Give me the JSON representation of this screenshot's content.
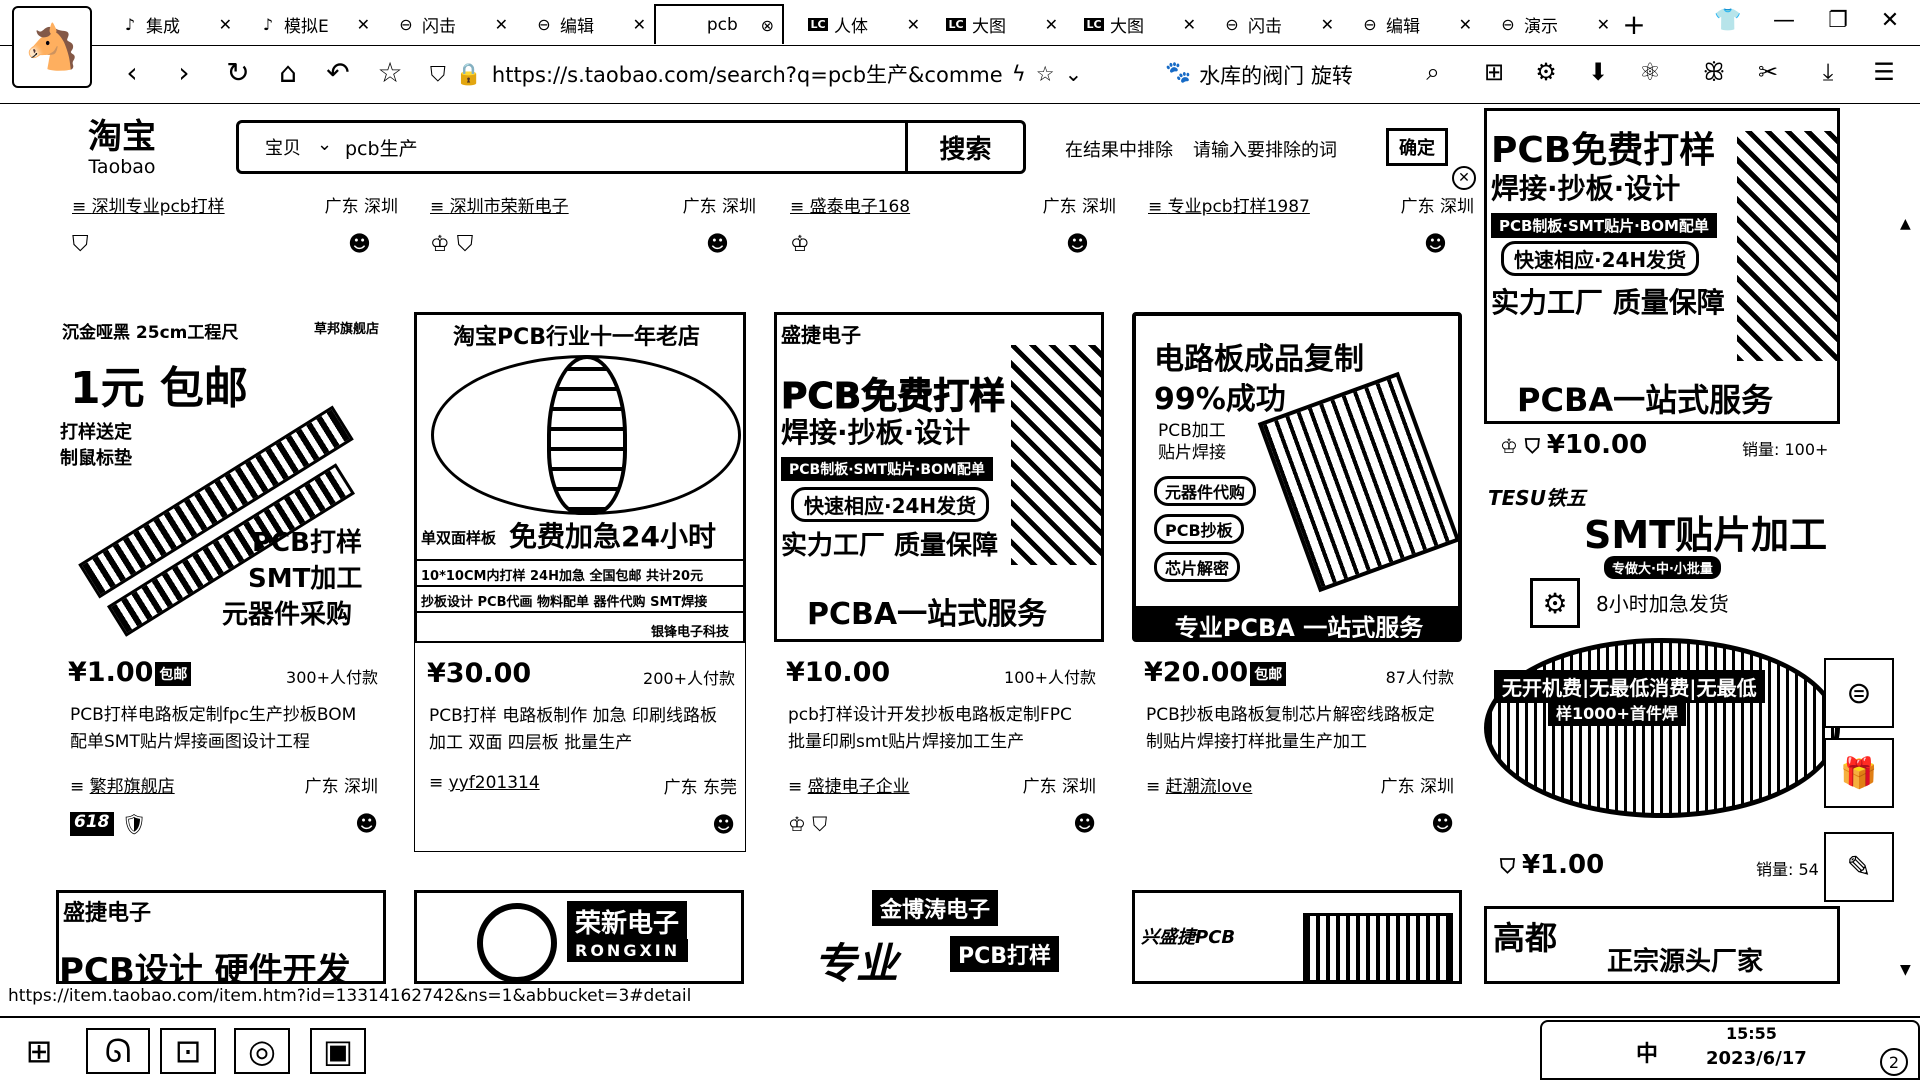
{
  "browser": {
    "tabs": [
      {
        "icon": "♪",
        "title": "集成",
        "active": false
      },
      {
        "icon": "♪",
        "title": "模拟E",
        "active": false
      },
      {
        "icon": "⊖",
        "title": "闪击",
        "active": false
      },
      {
        "icon": "⊖",
        "title": "编辑",
        "active": false
      },
      {
        "icon": "",
        "title": "pcb",
        "active": true
      },
      {
        "icon": "LC",
        "title": "人体",
        "active": false
      },
      {
        "icon": "LC",
        "title": "大图",
        "active": false
      },
      {
        "icon": "LC",
        "title": "大图",
        "active": false
      },
      {
        "icon": "⊖",
        "title": "闪击",
        "active": false
      },
      {
        "icon": "⊖",
        "title": "编辑",
        "active": false
      },
      {
        "icon": "⊖",
        "title": "演示",
        "active": false
      }
    ],
    "new_tab": "+",
    "url": "https://s.taobao.com/search?q=pcb生产&commer",
    "hot_search": "水库的阀门 旋转",
    "status_url": "https://item.taobao.com/item.htm?id=13314162742&ns=1&abbucket=3#detail"
  },
  "taobao": {
    "logo_cn": "淘宝",
    "logo_en": "Taobao",
    "search_category": "宝贝",
    "search_query": "pcb生产",
    "search_button": "搜索",
    "exclude_label": "在结果中排除",
    "exclude_placeholder": "请输入要排除的词",
    "confirm_button": "确定"
  },
  "top_shops": [
    {
      "shop": "深圳专业pcb打样",
      "location": "广东 深圳"
    },
    {
      "shop": "深圳市荣新电子",
      "location": "广东 深圳"
    },
    {
      "shop": "盛泰电子168",
      "location": "广东 深圳"
    },
    {
      "shop": "专业pcb打样1987",
      "location": "广东 深圳"
    }
  ],
  "products": [
    {
      "price": "¥1.00",
      "tag": "包邮",
      "sold": "300+人付款",
      "title": "PCB打样电路板定制fpc生产抄板BOM配单SMT贴片焊接画图设计工程",
      "shop": "繁邦旗舰店",
      "location": "广东 深圳",
      "badge": "618",
      "img": {
        "l1": "沉金哑黑 25cm工程尺",
        "l2": "草邦旗舰店",
        "l3": "1元 包邮",
        "l4": "打样送定制鼠标垫",
        "l5": "PCB打样",
        "l6": "SMT加工",
        "l7": "元器件采购"
      }
    },
    {
      "price": "¥30.00",
      "tag": "",
      "sold": "200+人付款",
      "title": "PCB打样 电路板制作 加急 印刷线路板加工 双面 四层板 批量生产",
      "shop": "yyf201314",
      "location": "广东 东莞",
      "badge": "",
      "img": {
        "l1": "淘宝PCB行业十一年老店",
        "l2": "单双面样板",
        "l3": "免费加急24小时",
        "l4": "10*10CM内打样 24H加急 全国包邮 共计20元",
        "l5": "抄板设计 PCB代画 物料配单 器件代购 SMT焊接",
        "l6": "银锋电子科技"
      }
    },
    {
      "price": "¥10.00",
      "tag": "",
      "sold": "100+人付款",
      "title": "pcb打样设计开发抄板电路板定制FPC批量印刷smt贴片焊接加工生产",
      "shop": "盛捷电子企业",
      "location": "广东 深圳",
      "badge": "",
      "img": {
        "l1": "盛捷电子",
        "l2": "PCB免费打样",
        "l3": "焊接·抄板·设计",
        "l4": "PCB制板·SMT贴片·BOM配单",
        "l5": "快速相应·24H发货",
        "l6": "实力工厂 质量保障",
        "l7": "PCBA一站式服务"
      }
    },
    {
      "price": "¥20.00",
      "tag": "包邮",
      "sold": "87人付款",
      "title": "PCB抄板电路板复制芯片解密线路板定制贴片焊接打样批量生产加工",
      "shop": "赶潮流love",
      "location": "广东 深圳",
      "badge": "",
      "img": {
        "l1": "电路板成品复制",
        "l2": "99%成功",
        "l3": "PCB加工",
        "l4": "贴片焊接",
        "l5": "元器件代购",
        "l6": "PCB抄板",
        "l7": "芯片解密",
        "l8": "专业PCBA 一站式服务"
      }
    }
  ],
  "bottom_ads": [
    {
      "text1": "盛捷电子",
      "text2": "PCB设计 硬件开发"
    },
    {
      "text1": "荣新电子",
      "text2": "RONGXIN"
    },
    {
      "text1": "金博涛电子",
      "text2": "专业",
      "text3": "PCB打样"
    },
    {
      "text1": "兴盛捷PCB",
      "text2": ""
    }
  ],
  "side_ads": [
    {
      "l1": "PCB免费打样",
      "l2": "焊接·抄板·设计",
      "l3": "PCB制板·SMT贴片·BOM配单",
      "l4": "快速相应·24H发货",
      "l5": "实力工厂 质量保障",
      "l6": "PCBA一站式服务",
      "price": "¥10.00",
      "sales": "销量: 100+"
    },
    {
      "brand": "TESU铁五",
      "l1": "SMT贴片加工",
      "l2": "专做大·中·小批量",
      "l3": "8小时加急发货",
      "l4": "无开机费|无最低消费|无最低",
      "l5": "样1000+首件焊",
      "price": "¥1.00",
      "sales": "销量: 54"
    }
  ],
  "side_ad3": {
    "text1": "高都",
    "text2": "正宗源头厂家"
  },
  "taskbar": {
    "time": "15:55",
    "date": "2023/6/17",
    "ime": "中"
  }
}
